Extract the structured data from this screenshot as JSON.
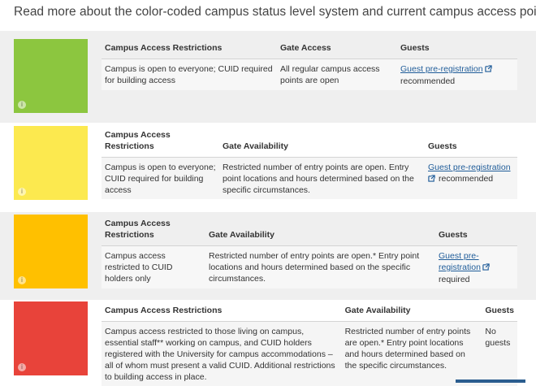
{
  "intro": "Read more about the color-coded campus status level system and current campus access points.",
  "levels": [
    {
      "color": "#8cc63f",
      "headers": [
        "Campus Access Restrictions",
        "Gate Access",
        "Guests"
      ],
      "restrictions": "Campus is open to everyone; CUID required for building access",
      "gate": "All regular campus access points are open",
      "guest_link": "Guest pre-registration",
      "guest_text": "recommended"
    },
    {
      "color": "#fce94f",
      "headers": [
        "Campus Access Restrictions",
        "Gate Availability",
        "Guests"
      ],
      "restrictions": "Campus is open to everyone; CUID required for building access",
      "gate": "Restricted number of entry points are open. Entry point locations and hours determined based on the specific circumstances.",
      "guest_link": "Guest pre-registration",
      "guest_text": "recommended"
    },
    {
      "color": "#ffc000",
      "headers": [
        "Campus Access Restrictions",
        "Gate Availability",
        "Guests"
      ],
      "restrictions": "Campus access restricted to CUID holders only",
      "gate": "Restricted number of entry points are open.* Entry point locations and hours determined based on the specific circumstances.",
      "guest_link": "Guest pre-registration",
      "guest_text": "required"
    },
    {
      "color": "#e8433a",
      "headers": [
        "Campus Access  Restrictions",
        "Gate Availability",
        "Guests"
      ],
      "restrictions": "Campus access restricted to those living on campus, essential staff** working on campus, and CUID holders registered with the University for campus accommodations – all of whom must present a valid CUID. Additional restrictions to building access in place.",
      "gate": "Restricted number of entry points are open.* Entry point locations and hours determined based on the specific circumstances.",
      "guest_text": "No guests"
    }
  ]
}
